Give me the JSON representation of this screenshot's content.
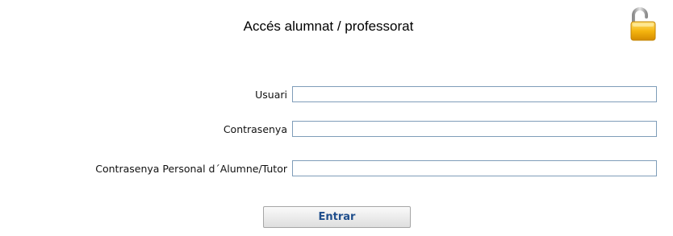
{
  "header": {
    "title": "Accés alumnat / professorat",
    "lock_icon": "open-padlock-icon",
    "lock_color": "#f5b50f"
  },
  "form": {
    "fields": [
      {
        "label": "Usuari",
        "value": "",
        "placeholder": ""
      },
      {
        "label": "Contrasenya",
        "value": "",
        "placeholder": ""
      },
      {
        "label": "Contrasenya Personal d´Alumne/Tutor",
        "value": "",
        "placeholder": ""
      }
    ],
    "submit_label": "Entrar",
    "input_border_color": "#7f9db9",
    "button_text_color": "#1f4e8c"
  }
}
